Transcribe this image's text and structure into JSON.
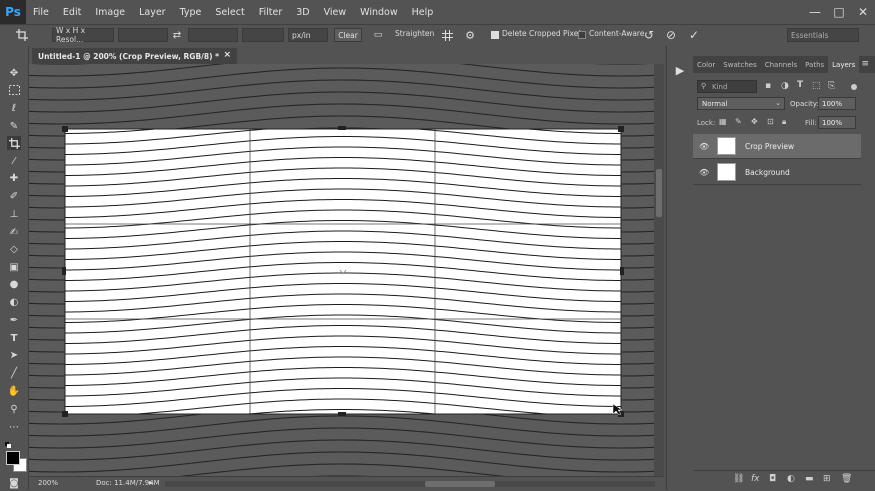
{
  "app": {
    "logo": "Ps"
  },
  "menu": [
    "File",
    "Edit",
    "Image",
    "Layer",
    "Type",
    "Select",
    "Filter",
    "3D",
    "View",
    "Window",
    "Help"
  ],
  "window_controls": [
    "—",
    "□",
    "✕"
  ],
  "options": {
    "ratio_preset": "W x H x Resol...",
    "unit": "px/in",
    "clear": "Clear",
    "straighten": "Straighten",
    "delete_cropped": "Delete Cropped Pixels",
    "content_aware": "Content-Aware",
    "workspace": "Essentials"
  },
  "document": {
    "tab_title": "Untitled-1 @ 200% (Crop Preview, RGB/8) *",
    "zoom": "200%",
    "doc_info": "Doc: 11.4M/7.94M"
  },
  "panel": {
    "tabs": [
      "Color",
      "Swatches",
      "Channels",
      "Paths",
      "Layers"
    ],
    "active_tab": "Layers",
    "kind": "Kind",
    "blend_mode": "Normal",
    "opacity_label": "Opacity:",
    "opacity": "100%",
    "lock_label": "Lock:",
    "fill_label": "Fill:",
    "fill": "100%",
    "layers": [
      {
        "name": "Crop Preview",
        "selected": true
      },
      {
        "name": "Background",
        "selected": false
      }
    ]
  },
  "colors": {
    "ui_bg": "#535353",
    "dark": "#424242",
    "accent": "#31a8ff"
  }
}
